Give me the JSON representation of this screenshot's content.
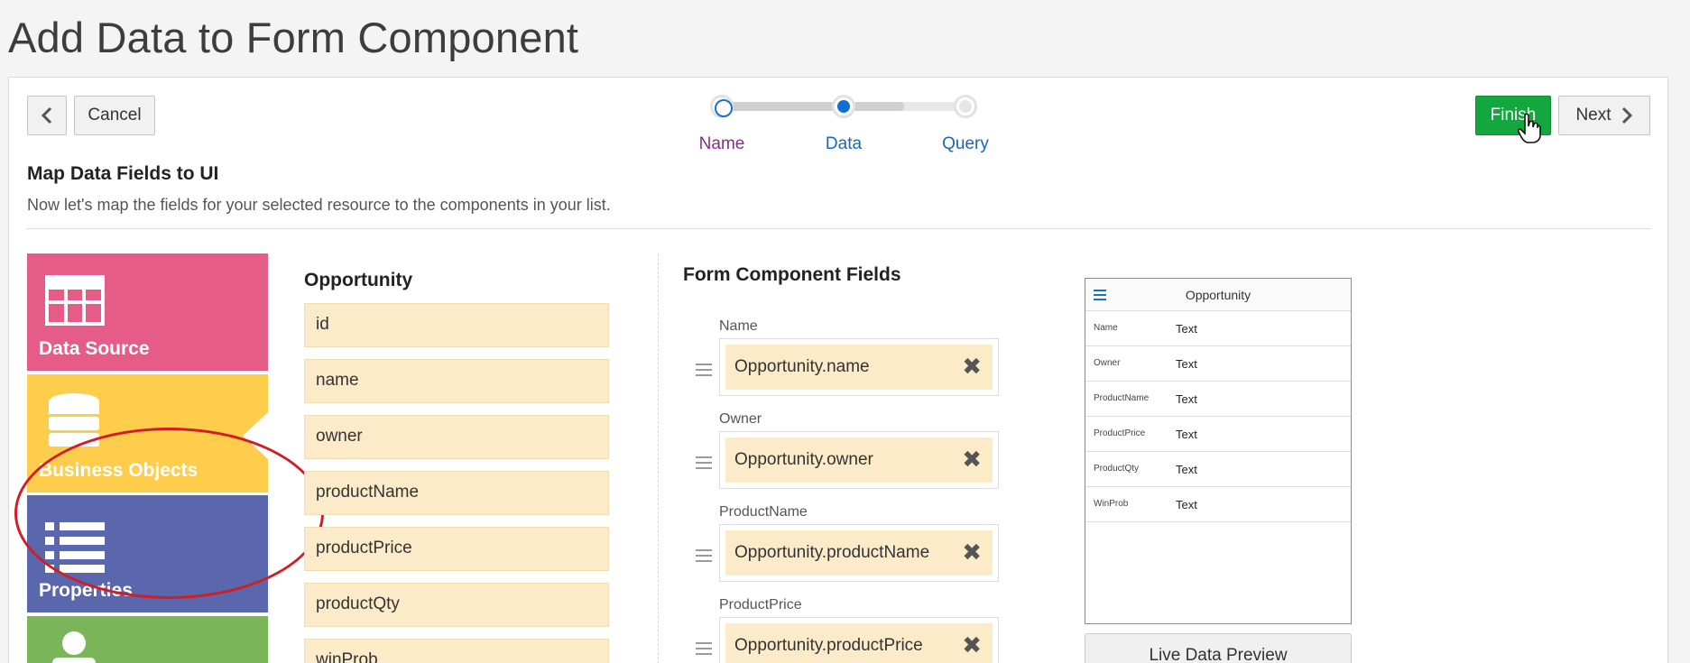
{
  "page": {
    "title": "Add Data to Form Component"
  },
  "toolbar": {
    "cancel_label": "Cancel",
    "finish_label": "Finish",
    "next_label": "Next"
  },
  "stepper": {
    "steps": [
      {
        "label": "Name",
        "state": "complete"
      },
      {
        "label": "Data",
        "state": "current"
      },
      {
        "label": "Query",
        "state": "upcoming"
      }
    ]
  },
  "section": {
    "title": "Map Data Fields to UI",
    "description": "Now let's map the fields for your selected resource to the components in your list."
  },
  "tiles": [
    {
      "label": "Data Source",
      "icon": "table-icon",
      "color": "#e65c88"
    },
    {
      "label": "Business Objects",
      "icon": "database-icon",
      "color": "#fecd4c"
    },
    {
      "label": "Properties",
      "icon": "list-icon",
      "color": "#5b67ad"
    },
    {
      "label": "",
      "icon": "person-icon",
      "color": "#7bb55a"
    }
  ],
  "source": {
    "title": "Opportunity",
    "fields": [
      "id",
      "name",
      "owner",
      "productName",
      "productPrice",
      "productQty",
      "winProb"
    ]
  },
  "form_fields": {
    "title": "Form Component Fields",
    "items": [
      {
        "label": "Name",
        "value": "Opportunity.name"
      },
      {
        "label": "Owner",
        "value": "Opportunity.owner"
      },
      {
        "label": "ProductName",
        "value": "Opportunity.productName"
      },
      {
        "label": "ProductPrice",
        "value": "Opportunity.productPrice"
      }
    ]
  },
  "preview": {
    "title": "Opportunity",
    "rows": [
      {
        "key": "Name",
        "value": "Text"
      },
      {
        "key": "Owner",
        "value": "Text"
      },
      {
        "key": "ProductName",
        "value": "Text"
      },
      {
        "key": "ProductPrice",
        "value": "Text"
      },
      {
        "key": "ProductQty",
        "value": "Text"
      },
      {
        "key": "WinProb",
        "value": "Text"
      }
    ],
    "live_button": "Live Data Preview"
  },
  "colors": {
    "finish": "#14a63f",
    "annotation": "#d11e26",
    "field_bg": "#fcebc8"
  }
}
